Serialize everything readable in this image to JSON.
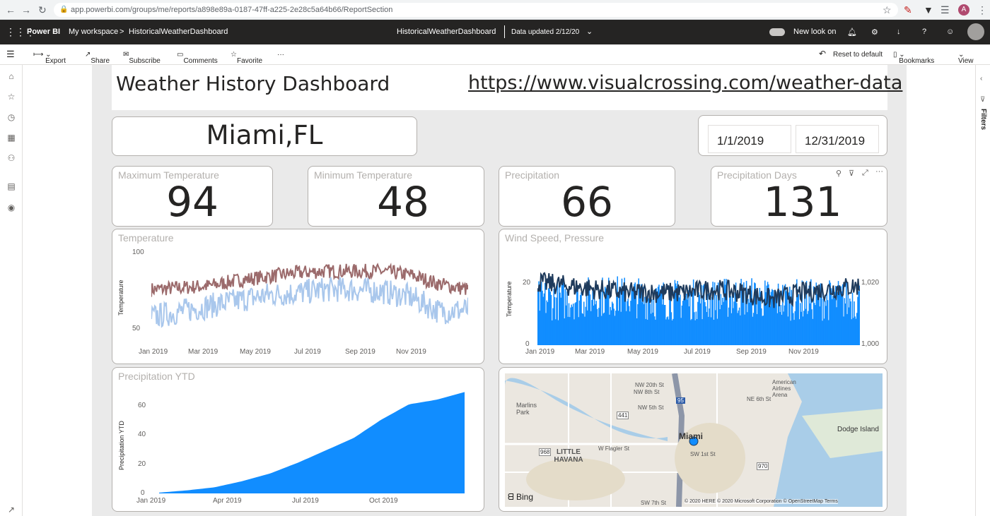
{
  "browser": {
    "url": "app.powerbi.com/groups/me/reports/a898e89a-0187-47ff-a225-2e28c5a64b66/ReportSection",
    "avatar": "A"
  },
  "header": {
    "app": "Power BI",
    "workspace": "My workspace",
    "sep": ">",
    "report": "HistoricalWeatherDashboard",
    "center_title": "HistoricalWeatherDashboard",
    "data_updated": "Data updated 2/12/20",
    "new_look": "New look on"
  },
  "commands": {
    "export": "Export",
    "share": "Share",
    "subscribe": "Subscribe",
    "comments": "Comments",
    "favorite": "Favorite",
    "more": "···",
    "reset": "Reset to default",
    "bookmarks": "Bookmarks",
    "view": "View"
  },
  "filters_label": "Filters",
  "report": {
    "title": "Weather History Dashboard",
    "link": "https://www.visualcrossing.com/weather-data",
    "location": "Miami,FL",
    "date_start": "1/1/2019",
    "date_end": "12/31/2019",
    "kpis": [
      {
        "label": "Maximum Temperature",
        "value": "94"
      },
      {
        "label": "Minimum Temperature",
        "value": "48"
      },
      {
        "label": "Precipitation",
        "value": "66"
      },
      {
        "label": "Precipitation Days",
        "value": "131"
      }
    ],
    "temp_chart": {
      "title": "Temperature",
      "ylabel": "Temperature",
      "yticks": [
        "100",
        "50"
      ],
      "xticks": [
        "Jan 2019",
        "Mar 2019",
        "May 2019",
        "Jul 2019",
        "Sep 2019",
        "Nov 2019"
      ]
    },
    "wind_chart": {
      "title": "Wind Speed, Pressure",
      "ylabel": "Temperature",
      "yticks": [
        "20",
        "0"
      ],
      "y2ticks": [
        "1,020",
        "1,000"
      ],
      "xticks": [
        "Jan 2019",
        "Mar 2019",
        "May 2019",
        "Jul 2019",
        "Sep 2019",
        "Nov 2019"
      ]
    },
    "precip_chart": {
      "title": "Precipitation YTD",
      "ylabel": "Precipitation YTD",
      "yticks": [
        "60",
        "40",
        "20",
        "0"
      ],
      "xticks": [
        "Jan 2019",
        "Apr 2019",
        "Jul 2019",
        "Oct 2019"
      ]
    },
    "map": {
      "provider": "Bing",
      "copyright": "© 2020 HERE  © 2020 Microsoft Corporation  © OpenStreetMap  Terms",
      "labels": [
        "Miami",
        "LITTLE HAVANA",
        "Marlins Park",
        "Dodge Island",
        "American Airlines Arena",
        "W Flagler St",
        "NW 8th St",
        "NW 5th St",
        "NW 20th St",
        "SW 1st St",
        "SW 7th St",
        "NE 6th St",
        "968",
        "970",
        "441",
        "95"
      ]
    }
  },
  "colors": {
    "max_temp": "#9b6a6b",
    "min_temp": "#a9c7ec",
    "bar_blue": "#118dff",
    "line_dark": "#1f3b5c",
    "pbi_bar": "#252423"
  },
  "chart_data": [
    {
      "type": "line",
      "title": "Temperature",
      "ylabel": "Temperature",
      "ylim": [
        50,
        100
      ],
      "x_range": [
        "2019-01-01",
        "2019-12-31"
      ],
      "series": [
        {
          "values_monthly": [
            78,
            79,
            80,
            83,
            85,
            87,
            88,
            88,
            88,
            86,
            81,
            78
          ]
        },
        {
          "values_monthly": [
            63,
            66,
            69,
            72,
            75,
            76,
            78,
            78,
            77,
            74,
            66,
            67
          ]
        }
      ]
    },
    {
      "type": "bar",
      "title": "Wind Speed, Pressure",
      "ylabel": "Temperature",
      "ylim": [
        0,
        25
      ],
      "y2lim": [
        1000,
        1025
      ],
      "x_range": [
        "2019-01-01",
        "2019-12-31"
      ],
      "series": [
        {
          "values_monthly": [
            13,
            13,
            14,
            14,
            13,
            13,
            13,
            14,
            13,
            13,
            13,
            13
          ]
        },
        {
          "values_monthly": [
            1018,
            1017,
            1016,
            1015,
            1015,
            1015,
            1016,
            1015,
            1013,
            1015,
            1016,
            1017
          ]
        }
      ]
    },
    {
      "type": "area",
      "title": "Precipitation YTD",
      "ylabel": "Precipitation YTD",
      "ylim": [
        0,
        68
      ],
      "x_range": [
        "2019-01-01",
        "2019-12-31"
      ],
      "series": [
        {
          "values_monthly": [
            0.5,
            2,
            4,
            8,
            13,
            20,
            28,
            36,
            48,
            58,
            61,
            66
          ]
        }
      ]
    }
  ]
}
